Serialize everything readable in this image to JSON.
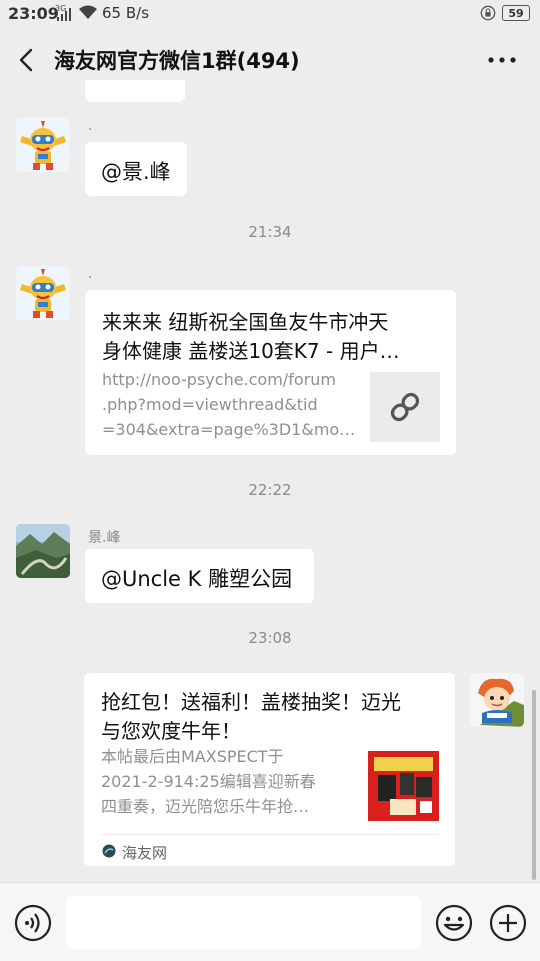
{
  "status_bar": {
    "time": "23:09",
    "signal": "3G",
    "speed": "65 B/s",
    "battery": "59"
  },
  "header": {
    "title": "海友网官方微信1群(494)"
  },
  "messages": {
    "m1": {
      "sender": ".",
      "text": "@景.峰"
    },
    "ts1": "21:34",
    "m2": {
      "sender": ".",
      "title_line1": "来来来 纽斯祝全国鱼友牛市冲天",
      "title_line2": "身体健康 盖楼送10套K7 - 用户…",
      "url_line1": "http://noo-psyche.com/forum",
      "url_line2": ".php?mod=viewthread&tid",
      "url_line3": "=304&extra=page%3D1&mo…"
    },
    "ts2": "22:22",
    "m3": {
      "sender": "景.峰",
      "text": "@Uncle K  雕塑公园"
    },
    "ts3": "23:08",
    "m4": {
      "title_line1": "抢红包！送福利！盖楼抽奖！迈光",
      "title_line2": "与您欢度牛年！",
      "desc_line1": "本帖最后由MAXSPECT于",
      "desc_line2": "2021-2-914:25编辑喜迎新春",
      "desc_line3": "四重奏，迈光陪您乐牛年抢…",
      "source": "海友网"
    }
  },
  "colors": {
    "background": "#ededed",
    "bubble": "#ffffff",
    "timestamp": "#8a8a8a"
  }
}
